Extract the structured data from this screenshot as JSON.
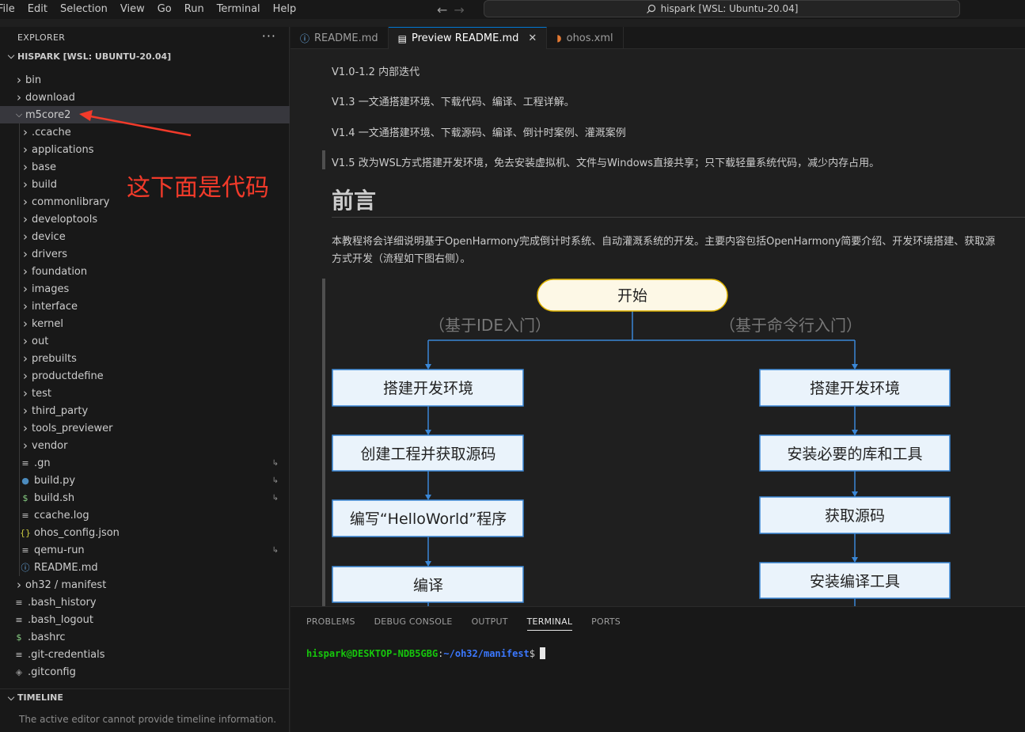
{
  "menubar": {
    "items": [
      "File",
      "Edit",
      "Selection",
      "View",
      "Go",
      "Run",
      "Terminal",
      "Help"
    ],
    "back_icon": "arrow-left-icon",
    "forward_icon": "arrow-right-icon",
    "search_text": "hispark [WSL: Ubuntu-20.04]"
  },
  "explorer": {
    "title": "EXPLORER",
    "more_icon": "ellipsis-icon",
    "root": "HISPARK [WSL: UBUNTU-20.04]",
    "items": [
      {
        "label": "bin",
        "kind": "folder",
        "depth": 1,
        "expanded": false
      },
      {
        "label": "download",
        "kind": "folder",
        "depth": 1,
        "expanded": false
      },
      {
        "label": "m5core2",
        "kind": "folder",
        "depth": 1,
        "expanded": true,
        "selected": true
      },
      {
        "label": ".ccache",
        "kind": "folder",
        "depth": 2,
        "expanded": false
      },
      {
        "label": "applications",
        "kind": "folder",
        "depth": 2,
        "expanded": false
      },
      {
        "label": "base",
        "kind": "folder",
        "depth": 2,
        "expanded": false
      },
      {
        "label": "build",
        "kind": "folder",
        "depth": 2,
        "expanded": false
      },
      {
        "label": "commonlibrary",
        "kind": "folder",
        "depth": 2,
        "expanded": false
      },
      {
        "label": "developtools",
        "kind": "folder",
        "depth": 2,
        "expanded": false
      },
      {
        "label": "device",
        "kind": "folder",
        "depth": 2,
        "expanded": false
      },
      {
        "label": "drivers",
        "kind": "folder",
        "depth": 2,
        "expanded": false
      },
      {
        "label": "foundation",
        "kind": "folder",
        "depth": 2,
        "expanded": false
      },
      {
        "label": "images",
        "kind": "folder",
        "depth": 2,
        "expanded": false
      },
      {
        "label": "interface",
        "kind": "folder",
        "depth": 2,
        "expanded": false
      },
      {
        "label": "kernel",
        "kind": "folder",
        "depth": 2,
        "expanded": false
      },
      {
        "label": "out",
        "kind": "folder",
        "depth": 2,
        "expanded": false
      },
      {
        "label": "prebuilts",
        "kind": "folder",
        "depth": 2,
        "expanded": false
      },
      {
        "label": "productdefine",
        "kind": "folder",
        "depth": 2,
        "expanded": false
      },
      {
        "label": "test",
        "kind": "folder",
        "depth": 2,
        "expanded": false
      },
      {
        "label": "third_party",
        "kind": "folder",
        "depth": 2,
        "expanded": false
      },
      {
        "label": "tools_previewer",
        "kind": "folder",
        "depth": 2,
        "expanded": false
      },
      {
        "label": "vendor",
        "kind": "folder",
        "depth": 2,
        "expanded": false
      },
      {
        "label": ".gn",
        "kind": "file",
        "icon": "lines-icon",
        "depth": 2,
        "link": true
      },
      {
        "label": "build.py",
        "kind": "file",
        "icon": "python-icon",
        "depth": 2,
        "link": true
      },
      {
        "label": "build.sh",
        "kind": "file",
        "icon": "dollar-icon",
        "depth": 2,
        "link": true
      },
      {
        "label": "ccache.log",
        "kind": "file",
        "icon": "lines-icon",
        "depth": 2
      },
      {
        "label": "ohos_config.json",
        "kind": "file",
        "icon": "braces-icon",
        "depth": 2
      },
      {
        "label": "qemu-run",
        "kind": "file",
        "icon": "lines-icon",
        "depth": 2,
        "link": true
      },
      {
        "label": "README.md",
        "kind": "file",
        "icon": "info-icon",
        "depth": 2
      },
      {
        "label": "oh32 / manifest",
        "kind": "folder",
        "depth": 1,
        "expanded": false
      },
      {
        "label": ".bash_history",
        "kind": "file",
        "icon": "lines-icon",
        "depth": 1
      },
      {
        "label": ".bash_logout",
        "kind": "file",
        "icon": "lines-icon",
        "depth": 1
      },
      {
        "label": ".bashrc",
        "kind": "file",
        "icon": "dollar-icon",
        "depth": 1
      },
      {
        "label": ".git-credentials",
        "kind": "file",
        "icon": "lines-icon",
        "depth": 1
      },
      {
        "label": ".gitconfig",
        "kind": "file",
        "icon": "git-icon",
        "depth": 1
      }
    ],
    "timeline_title": "TIMELINE",
    "timeline_msg": "The active editor cannot provide timeline information."
  },
  "annotation": {
    "text": "这下面是代码",
    "color": "#f23a2a"
  },
  "tabs": [
    {
      "label": "README.md",
      "icon": "info-icon",
      "active": false
    },
    {
      "label": "Preview README.md",
      "icon": "preview-icon",
      "active": true,
      "close_icon": "close-icon"
    },
    {
      "label": "ohos.xml",
      "icon": "rss-icon",
      "active": false
    }
  ],
  "preview": {
    "lines": [
      "V1.0-1.2 内部迭代",
      "V1.3 一文通搭建环境、下载代码、编译、工程详解。",
      "V1.4 一文通搭建环境、下载源码、编译、倒计时案例、灌溉案例"
    ],
    "quote": "V1.5 改为WSL方式搭建开发环境，免去安装虚拟机、文件与Windows直接共享；只下载轻量系统代码，减少内存占用。",
    "heading": "前言",
    "para1": "本教程将会详细说明基于OpenHarmony完成倒计时系统、自动灌溉系统的开发。主要内容包括OpenHarmony简要介绍、开发环境搭建、获取源",
    "para2": "方式开发（流程如下图右侧）。",
    "flow": {
      "start": "开始",
      "left_branch": "（基于IDE入门）",
      "right_branch": "（基于命令行入门）",
      "left_steps": [
        "搭建开发环境",
        "创建工程并获取源码",
        "编写“HelloWorld”程序",
        "编译"
      ],
      "right_steps": [
        "搭建开发环境",
        "安装必要的库和工具",
        "获取源码",
        "安装编译工具"
      ]
    }
  },
  "panel": {
    "tabs": [
      "PROBLEMS",
      "DEBUG CONSOLE",
      "OUTPUT",
      "TERMINAL",
      "PORTS"
    ],
    "active_tab": "TERMINAL",
    "prompt_user": "hispark@DESKTOP-NDB5GBG",
    "prompt_path": "~/oh32/manifest",
    "prompt_symbol": "$"
  },
  "colors": {
    "accent": "#0078d4",
    "term_green": "#16c60c",
    "term_blue": "#3b78ff",
    "flow_border": "#3a87d6",
    "flow_box": "#eaf3fb",
    "flow_start": "#fdf8e6",
    "flow_start_border": "#e0b400"
  }
}
